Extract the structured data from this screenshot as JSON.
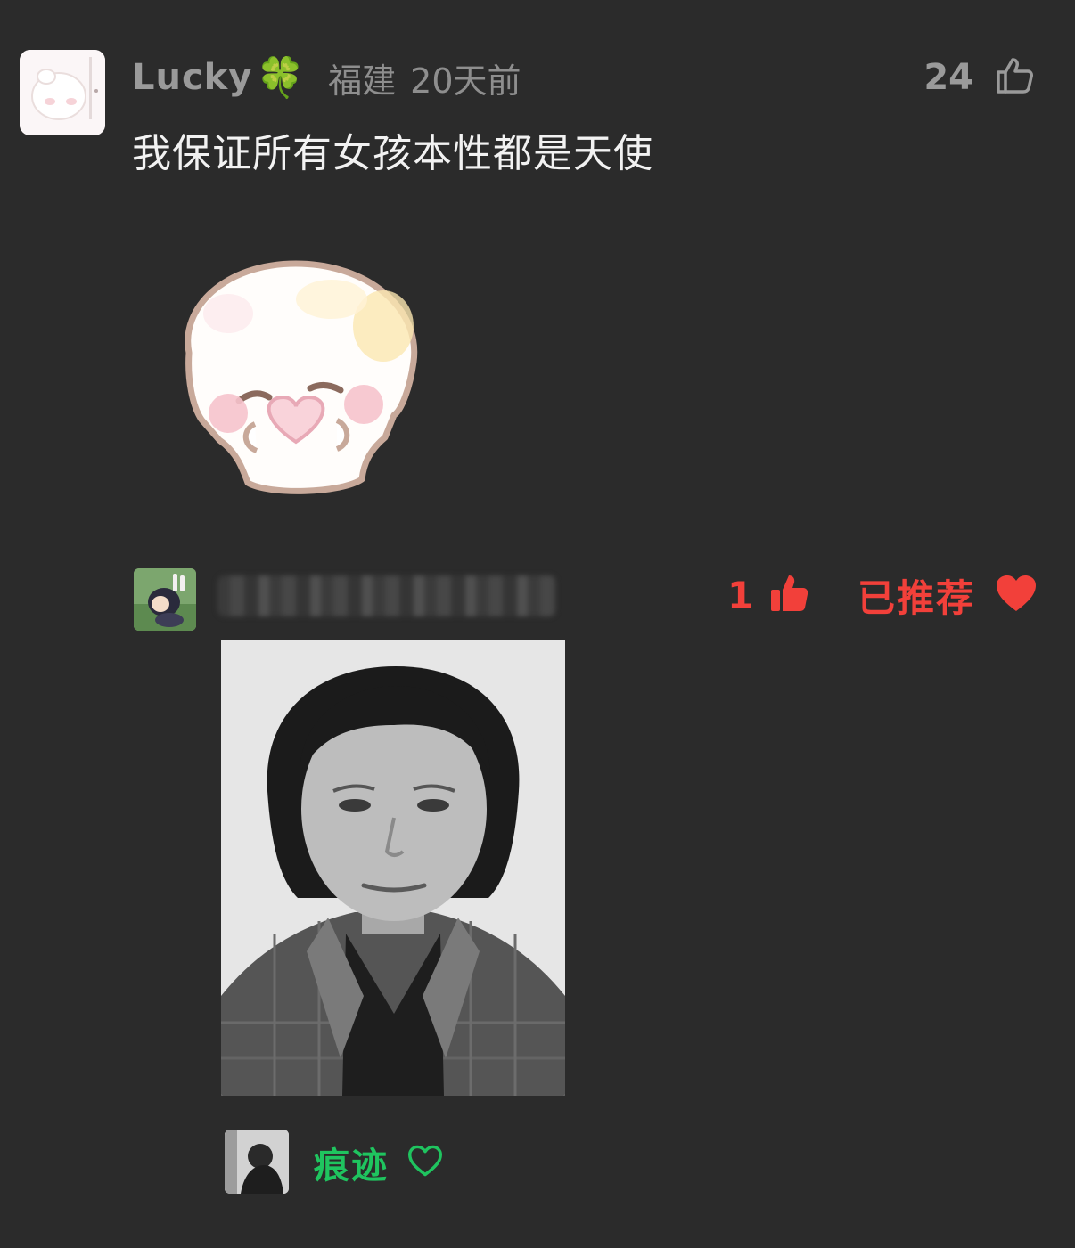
{
  "comment": {
    "username": "Lucky",
    "username_emoji": "🍀",
    "location": "福建",
    "time": "20天前",
    "like_count": "24",
    "text": "我保证所有女孩本性都是天使",
    "sticker": "bunny-heart-sticker"
  },
  "reply": {
    "like_count": "1",
    "recommend_label": "已推荐",
    "photo": "portrait-photo"
  },
  "liker": {
    "name": "痕迹"
  },
  "colors": {
    "background": "#2b2b2b",
    "accent_red": "#f2403a",
    "accent_green": "#1fc45f"
  }
}
